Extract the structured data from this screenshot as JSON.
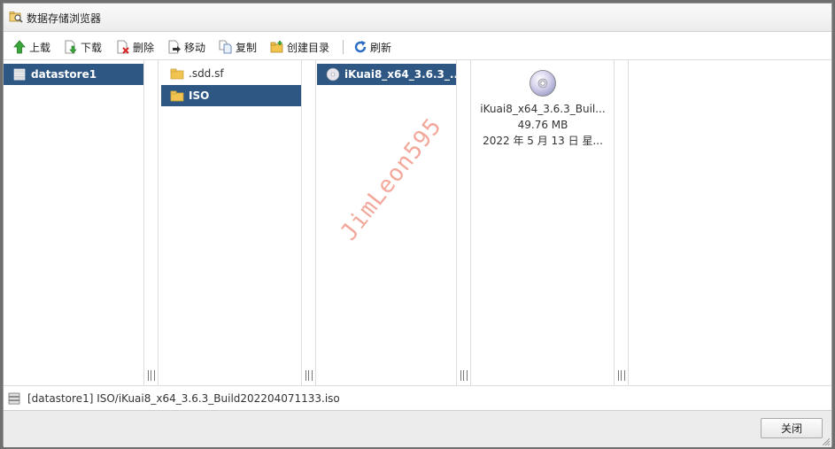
{
  "window": {
    "title": "数据存储浏览器"
  },
  "toolbar": {
    "upload": "上载",
    "download": "下载",
    "delete": "删除",
    "move": "移动",
    "copy": "复制",
    "mkdir": "创建目录",
    "refresh": "刷新"
  },
  "columns": {
    "datastores": [
      {
        "label": "datastore1",
        "selected": true
      }
    ],
    "folders": [
      {
        "label": ".sdd.sf",
        "selected": false
      },
      {
        "label": "ISO",
        "selected": true
      }
    ],
    "files": [
      {
        "label": "iKuai8_x64_3.6.3_...",
        "selected": true
      }
    ]
  },
  "preview": {
    "name": "iKuai8_x64_3.6.3_Buil...",
    "size": "49.76 MB",
    "date": "2022 年 5 月 13 日 星..."
  },
  "watermark": "JimLeon595",
  "status": {
    "path": "[datastore1] ISO/iKuai8_x64_3.6.3_Build202204071133.iso"
  },
  "footer": {
    "close_label": "关闭"
  },
  "colors": {
    "selection": "#2f5784",
    "folder": "#f2c44f",
    "watermark": "#f3a89b"
  }
}
